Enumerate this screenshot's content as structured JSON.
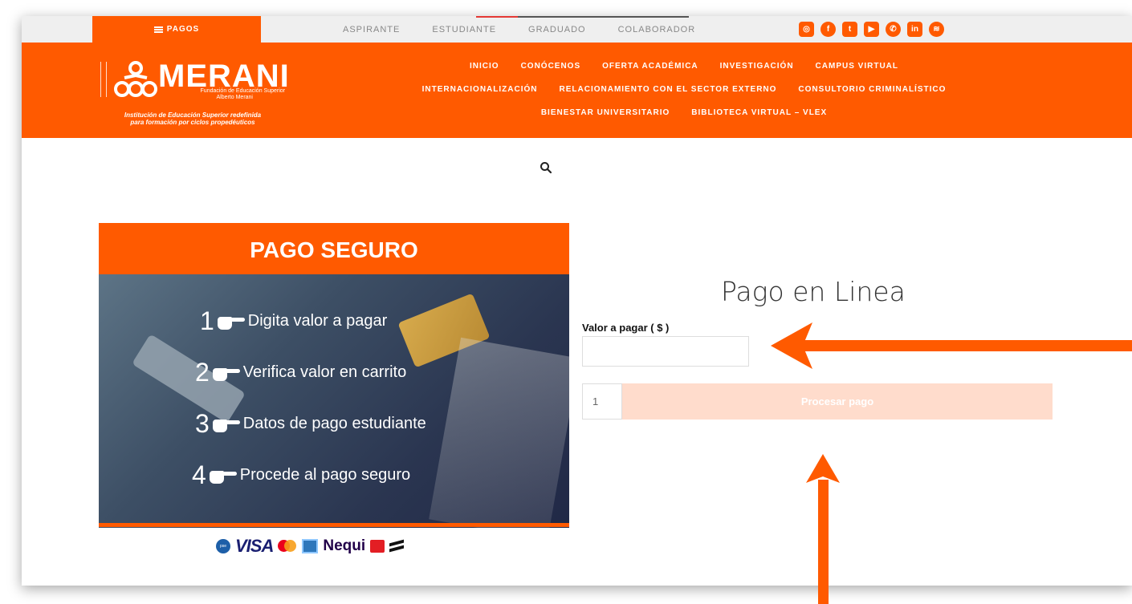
{
  "topbar": {
    "pagos_label": "PAGOS",
    "nav": [
      "ASPIRANTE",
      "ESTUDIANTE",
      "GRADUADO",
      "COLABORADOR"
    ],
    "socials": [
      "instagram-icon",
      "facebook-icon",
      "twitter-icon",
      "youtube-icon",
      "whatsapp-icon",
      "linkedin-icon",
      "spotify-icon"
    ]
  },
  "header": {
    "logo_word": "MERANI",
    "logo_sub1": "Fundación de Educación Superior",
    "logo_sub2": "Alberto Merani",
    "tagline_line1": "Institución de Educación Superior redefinida",
    "tagline_line2": "para formación por ciclos propedéuticos",
    "nav_rows": [
      [
        "INICIO",
        "CONÓCENOS",
        "OFERTA ACADÉMICA",
        "INVESTIGACIÓN",
        "CAMPUS VIRTUAL"
      ],
      [
        "INTERNACIONALIZACIÓN",
        "RELACIONAMIENTO CON EL SECTOR EXTERNO",
        "CONSULTORIO CRIMINALÍSTICO"
      ],
      [
        "BIENESTAR UNIVERSITARIO",
        "BIBLIOTECA VIRTUAL – VLEX"
      ]
    ]
  },
  "promo": {
    "title": "PAGO SEGURO",
    "steps": [
      {
        "num": "1",
        "text": "Digita valor a pagar"
      },
      {
        "num": "2",
        "text": "Verifica valor en carrito"
      },
      {
        "num": "3",
        "text": "Datos de pago estudiante"
      },
      {
        "num": "4",
        "text": "Procede al pago seguro"
      }
    ],
    "payment_logos": [
      "pse",
      "VISA",
      "mastercard",
      "american-express",
      "Nequi",
      "efecty",
      "stripe"
    ]
  },
  "form": {
    "title": "Pago en Linea",
    "amount_label": "Valor a pagar ( $ )",
    "amount_value": "",
    "quantity_value": "1",
    "process_label": "Procesar pago"
  },
  "colors": {
    "brand": "#ff5a00",
    "button_disabled": "#ffdccc",
    "arrow": "#ff5a00"
  }
}
